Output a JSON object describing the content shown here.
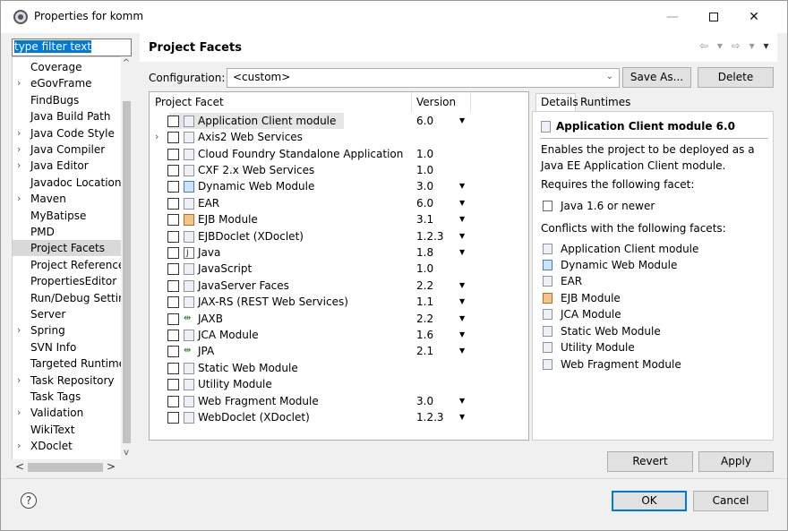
{
  "window": {
    "title": "Properties for komm",
    "controls": {
      "minimize": "—",
      "maximize": "",
      "close": "✕"
    }
  },
  "filter": {
    "value": "type filter text"
  },
  "nav": {
    "items": [
      {
        "label": "Coverage",
        "expandable": false
      },
      {
        "label": "eGovFrame",
        "expandable": true
      },
      {
        "label": "FindBugs",
        "expandable": false
      },
      {
        "label": "Java Build Path",
        "expandable": false
      },
      {
        "label": "Java Code Style",
        "expandable": true
      },
      {
        "label": "Java Compiler",
        "expandable": true
      },
      {
        "label": "Java Editor",
        "expandable": true
      },
      {
        "label": "Javadoc Location",
        "expandable": false
      },
      {
        "label": "Maven",
        "expandable": true
      },
      {
        "label": "MyBatipse",
        "expandable": false
      },
      {
        "label": "PMD",
        "expandable": false
      },
      {
        "label": "Project Facets",
        "expandable": false,
        "selected": true
      },
      {
        "label": "Project References",
        "expandable": false
      },
      {
        "label": "PropertiesEditor",
        "expandable": false
      },
      {
        "label": "Run/Debug Settings",
        "expandable": false
      },
      {
        "label": "Server",
        "expandable": false
      },
      {
        "label": "Spring",
        "expandable": true
      },
      {
        "label": "SVN Info",
        "expandable": false
      },
      {
        "label": "Targeted Runtimes",
        "expandable": false
      },
      {
        "label": "Task Repository",
        "expandable": true
      },
      {
        "label": "Task Tags",
        "expandable": false
      },
      {
        "label": "Validation",
        "expandable": true
      },
      {
        "label": "WikiText",
        "expandable": false
      },
      {
        "label": "XDoclet",
        "expandable": true
      }
    ]
  },
  "page": {
    "title": "Project Facets",
    "nav_back": "⇦ ▾",
    "nav_forward": "⇨ ▾",
    "nav_menu": "▾"
  },
  "configuration": {
    "label": "Configuration:",
    "value": "<custom>",
    "save_as_label": "Save As...",
    "delete_label": "Delete"
  },
  "facets": {
    "columns": {
      "facet": "Project Facet",
      "version": "Version"
    },
    "rows": [
      {
        "name": "Application Client module",
        "version": "6.0",
        "dropdown": true,
        "icon": "module",
        "selected": true
      },
      {
        "name": "Axis2 Web Services",
        "version": "",
        "dropdown": false,
        "icon": "module",
        "expandable": true
      },
      {
        "name": "Cloud Foundry Standalone Application",
        "version": "1.0",
        "dropdown": false,
        "icon": "module"
      },
      {
        "name": "CXF 2.x Web Services",
        "version": "1.0",
        "dropdown": false,
        "icon": "module"
      },
      {
        "name": "Dynamic Web Module",
        "version": "3.0",
        "dropdown": true,
        "icon": "web"
      },
      {
        "name": "EAR",
        "version": "6.0",
        "dropdown": true,
        "icon": "module"
      },
      {
        "name": "EJB Module",
        "version": "3.1",
        "dropdown": true,
        "icon": "ejb"
      },
      {
        "name": "EJBDoclet (XDoclet)",
        "version": "1.2.3",
        "dropdown": true,
        "icon": "module"
      },
      {
        "name": "Java",
        "version": "1.8",
        "dropdown": true,
        "icon": "java"
      },
      {
        "name": "JavaScript",
        "version": "1.0",
        "dropdown": false,
        "icon": "module"
      },
      {
        "name": "JavaServer Faces",
        "version": "2.2",
        "dropdown": true,
        "icon": "module"
      },
      {
        "name": "JAX-RS (REST Web Services)",
        "version": "1.1",
        "dropdown": true,
        "icon": "module"
      },
      {
        "name": "JAXB",
        "version": "2.2",
        "dropdown": true,
        "icon": "jaxb"
      },
      {
        "name": "JCA Module",
        "version": "1.6",
        "dropdown": true,
        "icon": "module"
      },
      {
        "name": "JPA",
        "version": "2.1",
        "dropdown": true,
        "icon": "jpa"
      },
      {
        "name": "Static Web Module",
        "version": "",
        "dropdown": false,
        "icon": "module"
      },
      {
        "name": "Utility Module",
        "version": "",
        "dropdown": false,
        "icon": "module"
      },
      {
        "name": "Web Fragment Module",
        "version": "3.0",
        "dropdown": true,
        "icon": "module"
      },
      {
        "name": "WebDoclet (XDoclet)",
        "version": "1.2.3",
        "dropdown": true,
        "icon": "module"
      }
    ]
  },
  "details": {
    "tabs": {
      "details": "Details",
      "runtimes": "Runtimes"
    },
    "title": "Application Client module 6.0",
    "description": "Enables the project to be deployed as a Java EE Application Client module.",
    "requires_heading": "Requires the following facet:",
    "requires": [
      {
        "label": "Java 1.6 or newer",
        "icon": "java"
      }
    ],
    "conflicts_heading": "Conflicts with the following facets:",
    "conflicts": [
      {
        "label": "Application Client module",
        "icon": "module"
      },
      {
        "label": "Dynamic Web Module",
        "icon": "web"
      },
      {
        "label": "EAR",
        "icon": "module"
      },
      {
        "label": "EJB Module",
        "icon": "ejb"
      },
      {
        "label": "JCA Module",
        "icon": "module"
      },
      {
        "label": "Static Web Module",
        "icon": "module"
      },
      {
        "label": "Utility Module",
        "icon": "module"
      },
      {
        "label": "Web Fragment Module",
        "icon": "module"
      }
    ]
  },
  "buttons": {
    "revert": "Revert",
    "apply": "Apply",
    "ok": "OK",
    "cancel": "Cancel",
    "help": "?"
  },
  "scroll": {
    "up": "^",
    "down": "v",
    "left": "<",
    "right": ">"
  },
  "colors": {
    "accent": "#0078d7",
    "selection": "#d9d9d9",
    "dialog_bg": "#f0f0f0"
  }
}
